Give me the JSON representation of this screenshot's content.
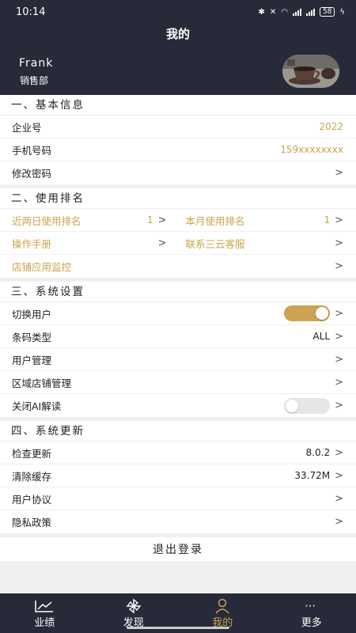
{
  "status": {
    "time": "10:14",
    "battery": "58"
  },
  "page_title": "我的",
  "user": {
    "name": "Frank",
    "department": "销售部"
  },
  "basic": {
    "title": "一、基本信息",
    "company_label": "企业号",
    "company_value": "2022",
    "phone_label": "手机号码",
    "phone_value": "159xxxxxxxx",
    "password_label": "修改密码"
  },
  "ranking": {
    "title": "二、使用排名",
    "two_day_label": "近两日使用排名",
    "two_day_value": "1",
    "month_label": "本月使用排名",
    "month_value": "1",
    "manual_label": "操作手册",
    "service_label": "联系三云客服",
    "monitor_label": "店铺应用监控"
  },
  "settings": {
    "title": "三、系统设置",
    "switch_user_label": "切换用户",
    "switch_user_on": true,
    "barcode_label": "条码类型",
    "barcode_value": "ALL",
    "user_mgmt_label": "用户管理",
    "region_label": "区域店铺管理",
    "ai_label": "关闭AI解读",
    "ai_on": false
  },
  "update": {
    "title": "四、系统更新",
    "check_label": "检查更新",
    "check_value": "8.0.2",
    "cache_label": "清除缓存",
    "cache_value": "33.72M",
    "agreement_label": "用户协议",
    "privacy_label": "隐私政策"
  },
  "logout_label": "退出登录",
  "tabs": [
    {
      "label": "业绩",
      "icon": "chart-line-icon"
    },
    {
      "label": "发现",
      "icon": "pinwheel-icon"
    },
    {
      "label": "我的",
      "icon": "person-icon",
      "active": true
    },
    {
      "label": "更多",
      "icon": "more-dots-icon"
    }
  ],
  "colors": {
    "accent": "#c8a44e",
    "header_bg": "#272a38",
    "toggle_on": "#cca253"
  },
  "chevron": ">"
}
